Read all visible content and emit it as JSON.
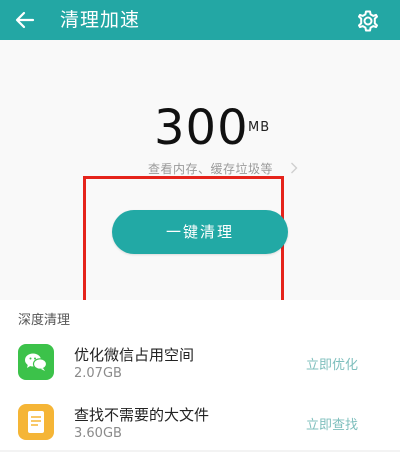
{
  "header": {
    "title": "清理加速",
    "back_icon": "arrow-left-icon",
    "settings_icon": "gear-icon",
    "background": "#23a7a4"
  },
  "summary": {
    "value": "300",
    "unit": "MB",
    "hint": "查看内存、缓存垃圾等",
    "clean_button": "一键清理",
    "accent": "#22a9a5",
    "highlight_color": "#e5231b"
  },
  "deep_clean": {
    "title": "深度清理",
    "items": [
      {
        "title": "优化微信占用空间",
        "size": "2.07GB",
        "action": "立即优化",
        "icon": "wechat-icon",
        "icon_color": "#3cc24a"
      },
      {
        "title": "查找不需要的大文件",
        "size": "3.60GB",
        "action": "立即查找",
        "icon": "document-icon",
        "icon_color": "#f5b536"
      }
    ]
  }
}
